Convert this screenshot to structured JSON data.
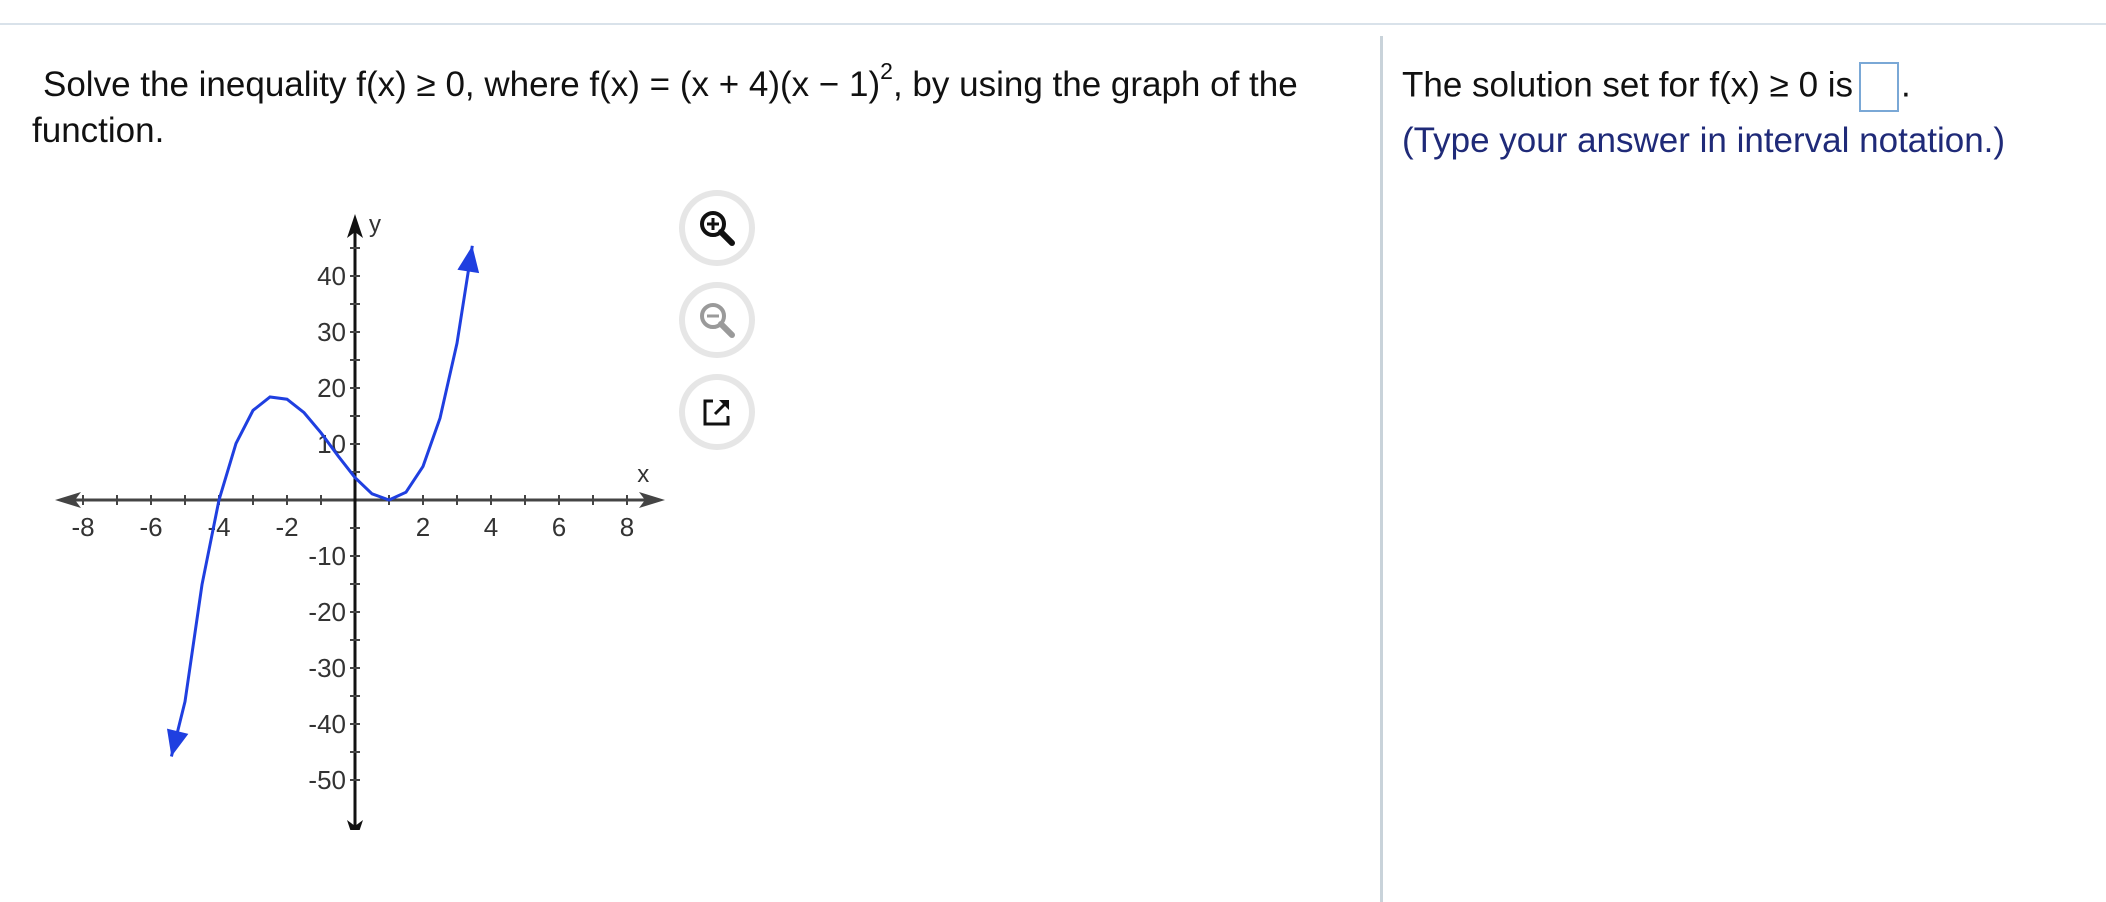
{
  "question": {
    "line1_prefix": "Solve the inequality f(x) ≥ 0, where f(x) = (x + 4)(x − 1)",
    "exponent": "2",
    "line1_suffix": ", by using the graph of the",
    "line2": "function."
  },
  "graph": {
    "x_label": "x",
    "y_label": "y",
    "x_tick_labels": [
      "-8",
      "-6",
      "-4",
      "-2",
      "2",
      "4",
      "6",
      "8"
    ],
    "y_tick_labels": [
      "40",
      "30",
      "20",
      "10",
      "-10",
      "-20",
      "-30",
      "-40",
      "-50"
    ],
    "curve_color": "#1f3fe0"
  },
  "chart_data": {
    "type": "line",
    "function": "f(x) = (x + 4)(x - 1)^2",
    "x_range": [
      -9,
      9
    ],
    "y_range": [
      -55,
      50
    ],
    "xlabel": "x",
    "ylabel": "y",
    "x_ticks": [
      -8,
      -6,
      -4,
      -2,
      2,
      4,
      6,
      8
    ],
    "y_ticks": [
      -50,
      -40,
      -30,
      -20,
      -10,
      10,
      20,
      30,
      40
    ],
    "series": [
      {
        "points": [
          [
            -5.4,
            -45.8
          ],
          [
            -5,
            -36
          ],
          [
            -4.5,
            -15.1
          ],
          [
            -4,
            0
          ],
          [
            -3.5,
            10.1
          ],
          [
            -3,
            16
          ],
          [
            -2.5,
            18.4
          ],
          [
            -2,
            18
          ],
          [
            -1.5,
            15.6
          ],
          [
            -1,
            12
          ],
          [
            -0.5,
            7.9
          ],
          [
            0,
            4
          ],
          [
            0.5,
            1.1
          ],
          [
            1,
            0
          ],
          [
            1.5,
            1.4
          ],
          [
            2,
            6
          ],
          [
            2.5,
            14.6
          ],
          [
            3,
            28
          ],
          [
            3.45,
            45.4
          ]
        ]
      }
    ]
  },
  "tools": {
    "zoom_in": "zoom-in-icon",
    "zoom_out": "zoom-out-icon",
    "popout": "external-link-icon"
  },
  "answer": {
    "prompt": "The solution set for f(x) ≥ 0 is",
    "period": ".",
    "hint": "(Type your answer in interval notation.)",
    "value": ""
  },
  "colors": {
    "hint_text": "#1f2a78",
    "answer_box_border": "#7aa8d6",
    "curve": "#1f3fe0"
  }
}
